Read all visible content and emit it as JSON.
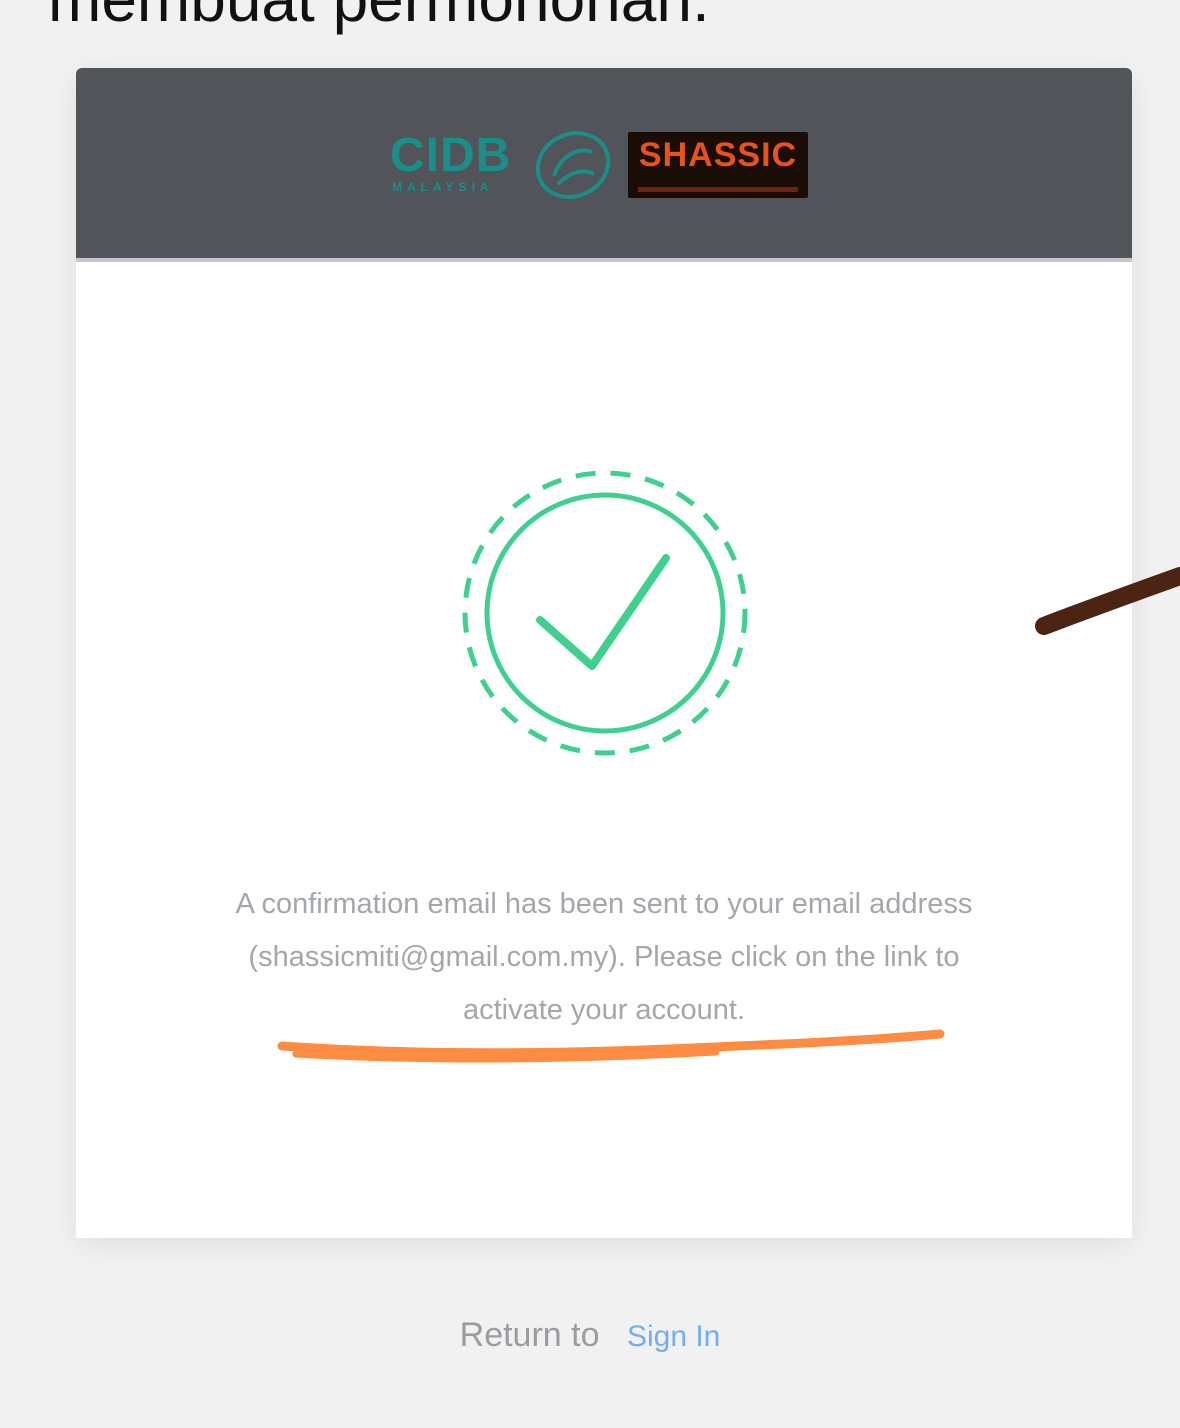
{
  "page_heading": "membuat permohonan.",
  "header": {
    "logos": {
      "cidb_text": "CIDB",
      "cidb_subtext": "MALAYSIA",
      "shassic_text": "SHASSIC"
    }
  },
  "icons": {
    "success": "check-circle-icon"
  },
  "colors": {
    "header_bg": "#515459",
    "success_green": "#3fcf8e",
    "link_blue": "#73aef2",
    "annotation_orange": "#ff8c42",
    "annotation_brown": "#4b2414"
  },
  "confirmation": {
    "message": "A confirmation email has been sent to your email address (shassicmiti@gmail.com.my). Please click on the link to activate your account."
  },
  "footer": {
    "return_text": "Return to",
    "sign_in_label": "Sign In"
  }
}
